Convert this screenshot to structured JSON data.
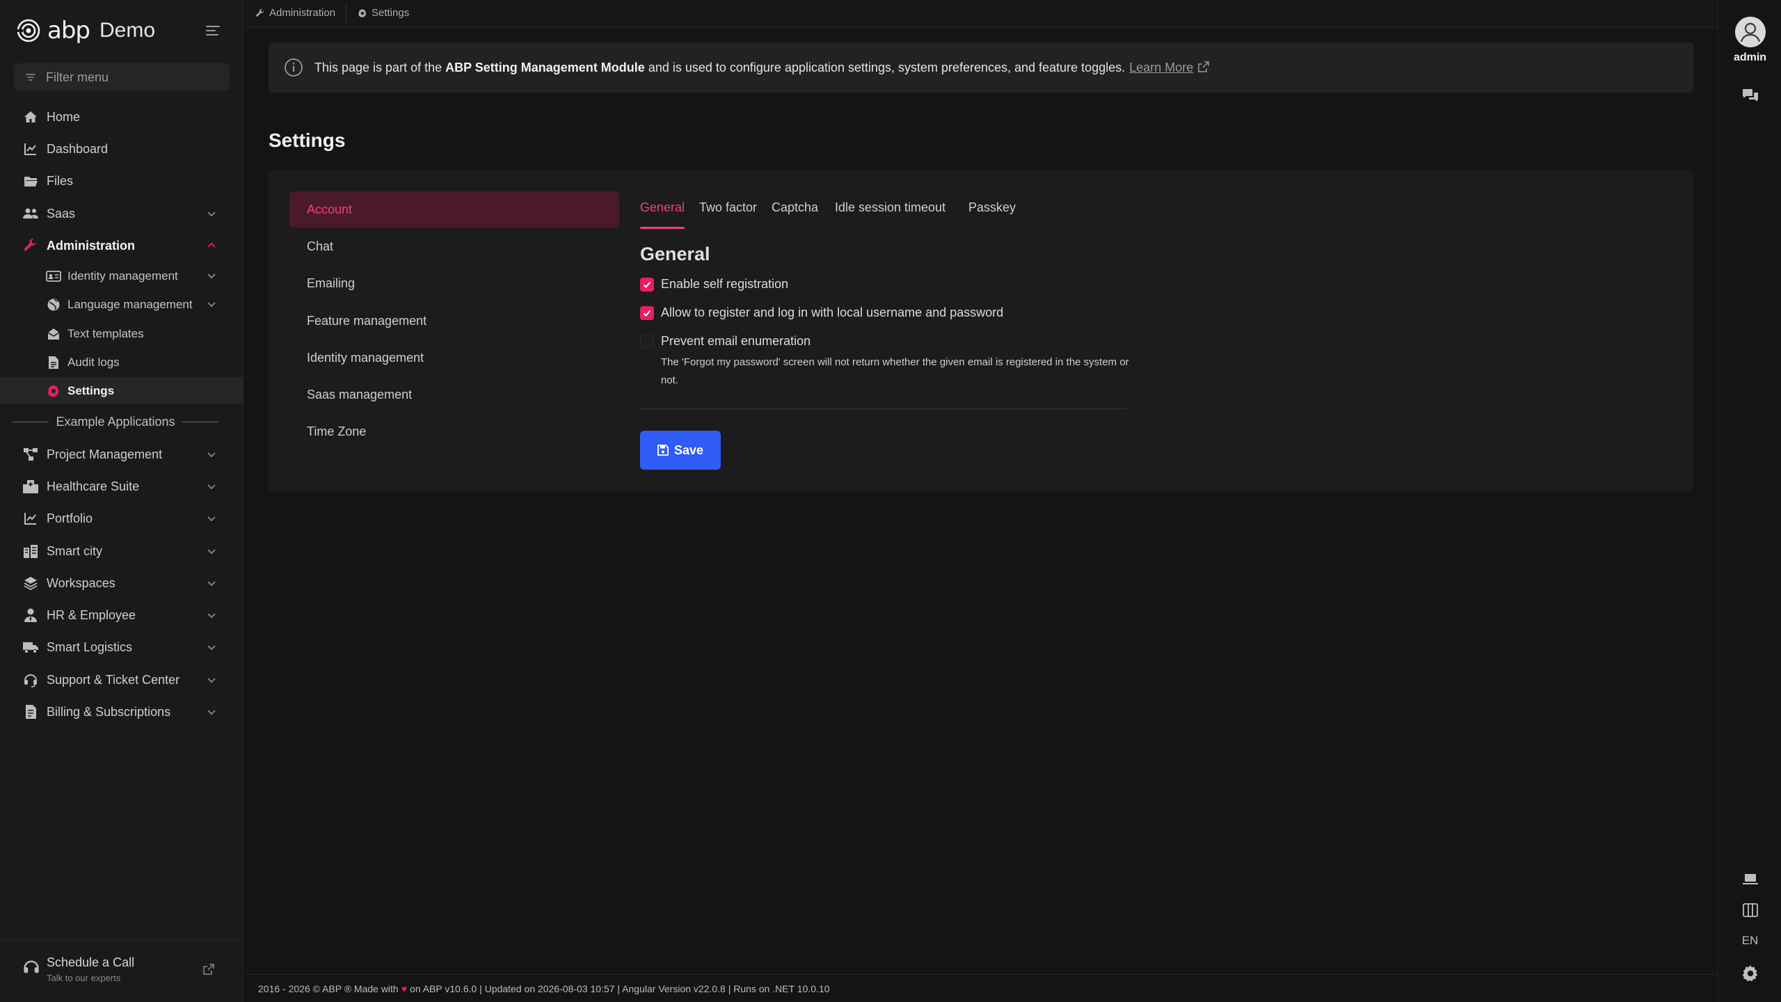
{
  "brand": {
    "name": "abp",
    "suffix": "Demo"
  },
  "sidebar": {
    "filter_placeholder": "Filter menu",
    "items": [
      {
        "label": "Home",
        "icon": "home-icon"
      },
      {
        "label": "Dashboard",
        "icon": "chart-line-icon"
      },
      {
        "label": "Files",
        "icon": "folder-open-icon"
      },
      {
        "label": "Saas",
        "icon": "users-icon"
      },
      {
        "label": "Administration",
        "icon": "wrench-icon"
      }
    ],
    "admin_children": [
      {
        "label": "Identity management",
        "icon": "id-card-icon"
      },
      {
        "label": "Language management",
        "icon": "globe-icon"
      },
      {
        "label": "Text templates",
        "icon": "envelope-open-icon"
      },
      {
        "label": "Audit logs",
        "icon": "file-text-icon"
      },
      {
        "label": "Settings",
        "icon": "gear-icon"
      }
    ],
    "section_label": "Example Applications",
    "example_items": [
      {
        "label": "Project Management",
        "icon": "diagram-icon"
      },
      {
        "label": "Healthcare Suite",
        "icon": "hospital-icon"
      },
      {
        "label": "Portfolio",
        "icon": "chart-line-icon"
      },
      {
        "label": "Smart city",
        "icon": "city-icon"
      },
      {
        "label": "Workspaces",
        "icon": "layers-icon"
      },
      {
        "label": "HR & Employee",
        "icon": "user-tie-icon"
      },
      {
        "label": "Smart Logistics",
        "icon": "truck-icon"
      },
      {
        "label": "Support & Ticket Center",
        "icon": "headset-icon"
      },
      {
        "label": "Billing & Subscriptions",
        "icon": "invoice-icon"
      }
    ],
    "schedule": {
      "title": "Schedule a Call",
      "subtitle": "Talk to our experts"
    }
  },
  "breadcrumb": [
    {
      "label": "Administration",
      "icon": "wrench-icon"
    },
    {
      "label": "Settings",
      "icon": "gear-icon"
    }
  ],
  "notice": {
    "prefix": "This page is part of the ",
    "module": "ABP Setting Management Module",
    "suffix": " and is used to configure application settings, system preferences, and feature toggles.",
    "link": "Learn More"
  },
  "page_title": "Settings",
  "settings_groups": [
    "Account",
    "Chat",
    "Emailing",
    "Feature management",
    "Identity management",
    "Saas management",
    "Time Zone"
  ],
  "tabs": [
    "General",
    "Two factor",
    "Captcha",
    "Idle session timeout",
    "Passkey"
  ],
  "general": {
    "title": "General",
    "options": [
      {
        "label": "Enable self registration",
        "checked": true
      },
      {
        "label": "Allow to register and log in with local username and password",
        "checked": true
      },
      {
        "label": "Prevent email enumeration",
        "checked": false
      }
    ],
    "help": "The 'Forgot my password' screen will not return whether the given email is registered in the system or not."
  },
  "save_label": "Save",
  "footer": {
    "left": "2016 - 2026 © ABP ® Made with",
    "right": "on ABP v10.6.0 | Updated on 2026-08-03 10:57 | Angular Version v22.0.8 | Runs on .NET 10.0.10"
  },
  "user": {
    "name": "admin"
  },
  "language": "EN",
  "colors": {
    "accent": "#e91e63",
    "primary_button": "#2f5cf6",
    "background": "#141414"
  }
}
